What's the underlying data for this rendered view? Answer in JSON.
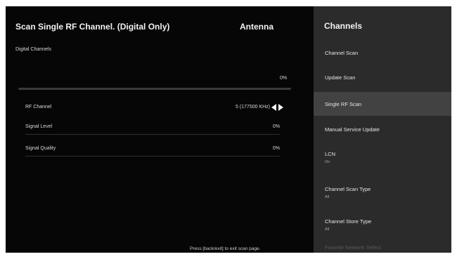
{
  "scan": {
    "title": "Scan Single RF Channel. (Digital Only)",
    "source": "Antenna",
    "section_label": "Digital Channels",
    "progress_text": "0%",
    "progress": 0,
    "rf_channel_label": "RF Channel",
    "rf_channel_value": "5 (177500 KHz)",
    "signal_level_label": "Signal Level",
    "signal_level_value": "0%",
    "signal_quality_label": "Signal Quality",
    "signal_quality_value": "0%",
    "footer_hint": "Press [back/exit] to exit scan page."
  },
  "panel": {
    "title": "Channels",
    "items": [
      {
        "label": "Channel Scan"
      },
      {
        "label": "Update Scan"
      },
      {
        "label": "Single RF Scan",
        "selected": true
      },
      {
        "label": "Manual Service Update"
      },
      {
        "label": "LCN",
        "value": "On"
      },
      {
        "label": "Channel Scan Type",
        "value": "All"
      },
      {
        "label": "Channel Store Type",
        "value": "All"
      },
      {
        "label": "Favorite Network Select"
      }
    ]
  },
  "colors": {
    "screen_bg": "#060606",
    "panel_bg": "#2b2b2b",
    "selected_bg": "#424242",
    "text": "#f2f2f2"
  }
}
